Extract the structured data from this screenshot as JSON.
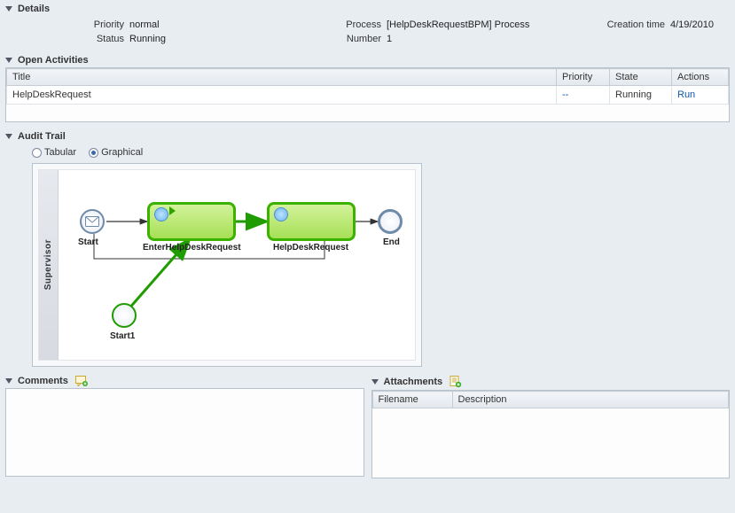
{
  "details": {
    "header": "Details",
    "priority_label": "Priority",
    "priority_value": "normal",
    "status_label": "Status",
    "status_value": "Running",
    "process_label": "Process",
    "process_value": "[HelpDeskRequestBPM] Process",
    "number_label": "Number",
    "number_value": "1",
    "creation_label": "Creation time",
    "creation_value": "4/19/2010"
  },
  "open_activities": {
    "header": "Open Activities",
    "columns": {
      "title": "Title",
      "priority": "Priority",
      "state": "State",
      "actions": "Actions"
    },
    "rows": [
      {
        "title": "HelpDeskRequest",
        "priority": "--",
        "state": "Running",
        "action": "Run"
      }
    ]
  },
  "audit_trail": {
    "header": "Audit Trail",
    "tabular_label": "Tabular",
    "graphical_label": "Graphical",
    "selected": "graphical",
    "lane": "Supervisor",
    "nodes": {
      "start": "Start",
      "enter": "EnterHelpDeskRequest",
      "helpdesk": "HelpDeskRequest",
      "end": "End",
      "start1": "Start1"
    }
  },
  "comments": {
    "header": "Comments"
  },
  "attachments": {
    "header": "Attachments",
    "columns": {
      "filename": "Filename",
      "description": "Description"
    }
  }
}
